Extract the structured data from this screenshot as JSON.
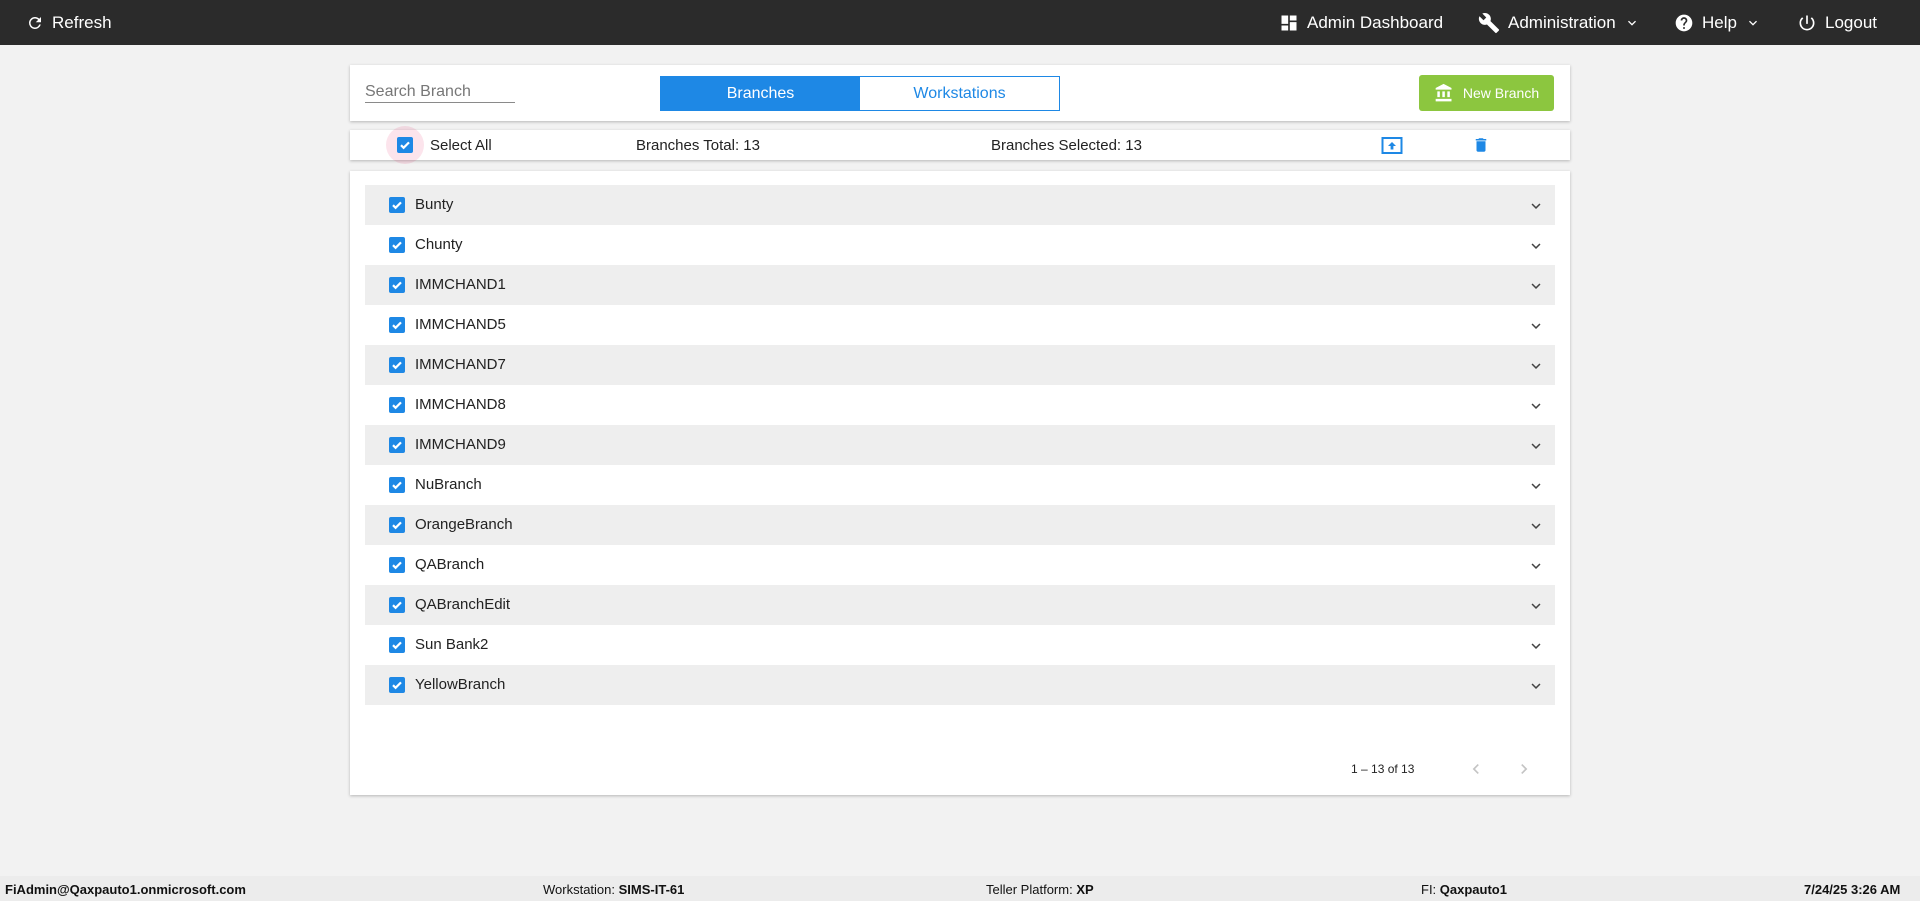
{
  "topbar": {
    "refresh_label": "Refresh",
    "admin_dashboard_label": "Admin Dashboard",
    "administration_label": "Administration",
    "help_label": "Help",
    "logout_label": "Logout"
  },
  "header": {
    "search_placeholder": "Search Branch",
    "tabs": [
      {
        "label": "Branches",
        "active": true
      },
      {
        "label": "Workstations",
        "active": false
      }
    ],
    "new_branch_label": "New Branch"
  },
  "select_bar": {
    "select_all_label": "Select All",
    "select_all_checked": true,
    "branches_total": "Branches Total: 13",
    "branches_selected": "Branches Selected: 13"
  },
  "branches": [
    {
      "name": "Bunty",
      "checked": true
    },
    {
      "name": "Chunty",
      "checked": true
    },
    {
      "name": "IMMCHAND1",
      "checked": true
    },
    {
      "name": "IMMCHAND5",
      "checked": true
    },
    {
      "name": "IMMCHAND7",
      "checked": true
    },
    {
      "name": "IMMCHAND8",
      "checked": true
    },
    {
      "name": "IMMCHAND9",
      "checked": true
    },
    {
      "name": "NuBranch",
      "checked": true
    },
    {
      "name": "OrangeBranch",
      "checked": true
    },
    {
      "name": "QABranch",
      "checked": true
    },
    {
      "name": "QABranchEdit",
      "checked": true
    },
    {
      "name": "Sun Bank2",
      "checked": true
    },
    {
      "name": "YellowBranch",
      "checked": true
    }
  ],
  "paginator": {
    "range_label": "1 – 13 of 13"
  },
  "footer": {
    "user": "FiAdmin@Qaxpauto1.onmicrosoft.com",
    "workstation_label": "Workstation:",
    "workstation_value": "SIMS-IT-61",
    "teller_platform_label": "Teller Platform:",
    "teller_platform_value": "XP",
    "fi_label": "FI:",
    "fi_value": "Qaxpauto1",
    "datetime": "7/24/25 3:26 AM"
  },
  "colors": {
    "topbar": "#2b2b2b",
    "accent": "#1e88e5",
    "new_branch_button": "#8cc63f",
    "row_shade": "#eeeeee"
  }
}
